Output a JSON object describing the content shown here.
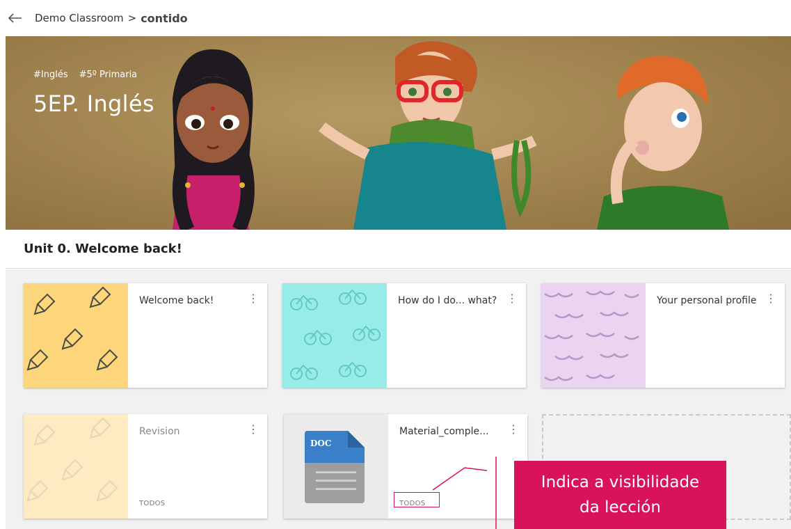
{
  "topbar": {
    "breadcrumb_root": "Demo Classroom",
    "breadcrumb_sep": ">",
    "breadcrumb_current": "contido"
  },
  "banner": {
    "tags": [
      "#Inglés",
      "#5º Primaria"
    ],
    "course_title": "5EP. Inglés"
  },
  "unit": {
    "title": "Unit 0. Welcome back!"
  },
  "cards": [
    {
      "title": "Welcome back!",
      "thumb": "pencil-pattern",
      "thumb_color": "#fdd57a",
      "visibility": ""
    },
    {
      "title": "How do I do... what?",
      "thumb": "bicycle-pattern",
      "thumb_color": "#98ece8",
      "visibility": ""
    },
    {
      "title": "Your personal profile",
      "thumb": "mustache-pattern",
      "thumb_color": "#ead4f0",
      "visibility": ""
    },
    {
      "title": "Revision",
      "thumb": "pencil-pattern",
      "thumb_color": "#fdd57a",
      "visibility": "TODOS"
    },
    {
      "title": "Material_comple...",
      "thumb": "doc-file-icon",
      "thumb_color": "#ebebeb",
      "visibility": "TODOS"
    }
  ],
  "doc_label": "DOC",
  "kebab_glyph": "⋮",
  "annotation": {
    "text_line1": "Indica a visibilidade",
    "text_line2": "da lección",
    "color": "#d8125b"
  }
}
